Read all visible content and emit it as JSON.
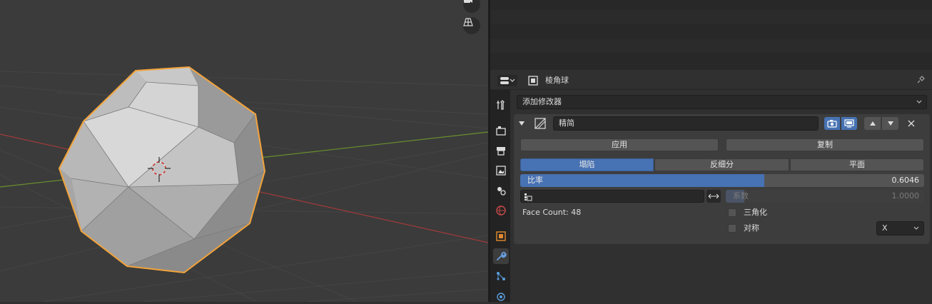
{
  "viewport": {
    "icons": [
      "camera-icon",
      "grid-perspective-icon"
    ]
  },
  "properties": {
    "object_name": "棱角球",
    "add_modifier_label": "添加修改器",
    "modifier": {
      "name": "精简",
      "apply_label": "应用",
      "duplicate_label": "复制",
      "modes": [
        "塌陷",
        "反细分",
        "平面"
      ],
      "active_mode": "塌陷",
      "ratio_label": "比率",
      "ratio_value": "0.6046",
      "ratio_fraction": 0.6046,
      "vertex_group_value": "",
      "factor_label": "系数",
      "factor_value": "1.0000",
      "face_count_text": "Face Count: 48",
      "triangulate_label": "三角化",
      "symmetry_label": "对称",
      "symmetry_axis": "X"
    }
  },
  "colors": {
    "accent": "#4772b3",
    "selection_outline": "#f2a33a",
    "x_axis": "#a33a3a",
    "y_axis": "#6a8f2e"
  }
}
